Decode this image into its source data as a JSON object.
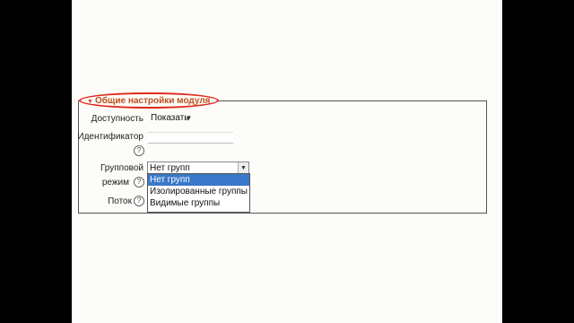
{
  "section": {
    "title": "Общие настройки модуля"
  },
  "fields": {
    "availability": {
      "label": "Доступность",
      "value": "Показать"
    },
    "identifier": {
      "label": "Идентификатор",
      "value": ""
    },
    "group_mode": {
      "label_line1": "Групповой",
      "label_line2": "режим",
      "value": "Нет групп",
      "options": [
        "Нет групп",
        "Изолированные группы",
        "Видимые группы"
      ]
    },
    "stream": {
      "label": "Поток"
    }
  },
  "icons": {
    "help": "?"
  },
  "colors": {
    "highlight": "#e0281c",
    "selected_option": "#3a78c9"
  }
}
